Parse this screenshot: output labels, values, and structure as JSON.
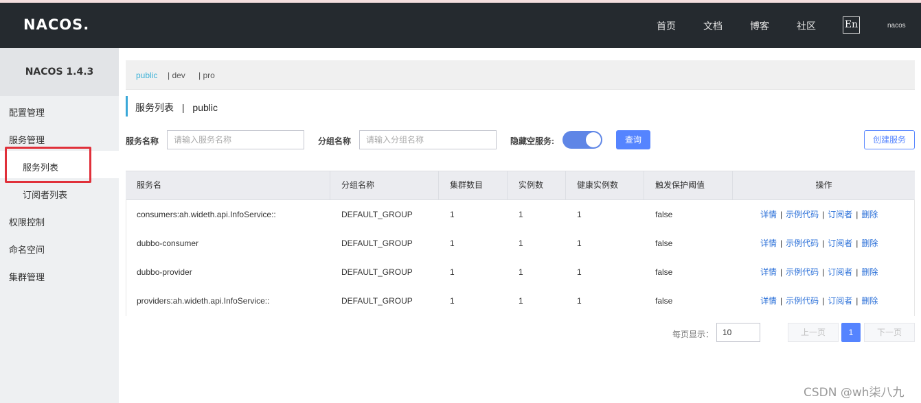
{
  "header": {
    "logo": "NACOS.",
    "nav": [
      "首页",
      "文档",
      "博客",
      "社区"
    ],
    "lang_button": "En",
    "user": "nacos"
  },
  "sidebar": {
    "version_title": "NACOS 1.4.3",
    "menu": {
      "config_mgmt": "配置管理",
      "service_mgmt": "服务管理",
      "service_list": "服务列表",
      "subscriber_list": "订阅者列表",
      "access_control": "权限控制",
      "namespace": "命名空间",
      "cluster_mgmt": "集群管理"
    }
  },
  "namespaces": {
    "items": [
      "public",
      "| dev",
      "| pro"
    ],
    "active": "public"
  },
  "page": {
    "title": "服务列表",
    "separator": "|",
    "namespace": "public"
  },
  "filters": {
    "service_name_label": "服务名称",
    "service_name_placeholder": "请输入服务名称",
    "group_name_label": "分组名称",
    "group_name_placeholder": "请输入分组名称",
    "hide_empty_label": "隐藏空服务:",
    "hide_empty_on": true,
    "query_button": "查询",
    "create_button": "创建服务"
  },
  "table": {
    "columns": [
      "服务名",
      "分组名称",
      "集群数目",
      "实例数",
      "健康实例数",
      "触发保护阈值",
      "操作"
    ],
    "rows": [
      [
        "consumers:ah.wideth.api.InfoService::",
        "DEFAULT_GROUP",
        "1",
        "1",
        "1",
        "false"
      ],
      [
        "dubbo-consumer",
        "DEFAULT_GROUP",
        "1",
        "1",
        "1",
        "false"
      ],
      [
        "dubbo-provider",
        "DEFAULT_GROUP",
        "1",
        "1",
        "1",
        "false"
      ],
      [
        "providers:ah.wideth.api.InfoService::",
        "DEFAULT_GROUP",
        "1",
        "1",
        "1",
        "false"
      ]
    ],
    "actions": [
      "详情",
      "示例代码",
      "订阅者",
      "删除"
    ],
    "action_separator": "|"
  },
  "pagination": {
    "page_size_label": "每页显示：",
    "page_size": "10",
    "prev": "上一页",
    "current_page": "1",
    "next": "下一页"
  },
  "watermark": "CSDN @wh柒八九",
  "colors": {
    "header_bg": "#252a2f",
    "accent": "#5584ff",
    "namespace_active": "#3bb1d7",
    "highlight_box": "#e0303a"
  }
}
